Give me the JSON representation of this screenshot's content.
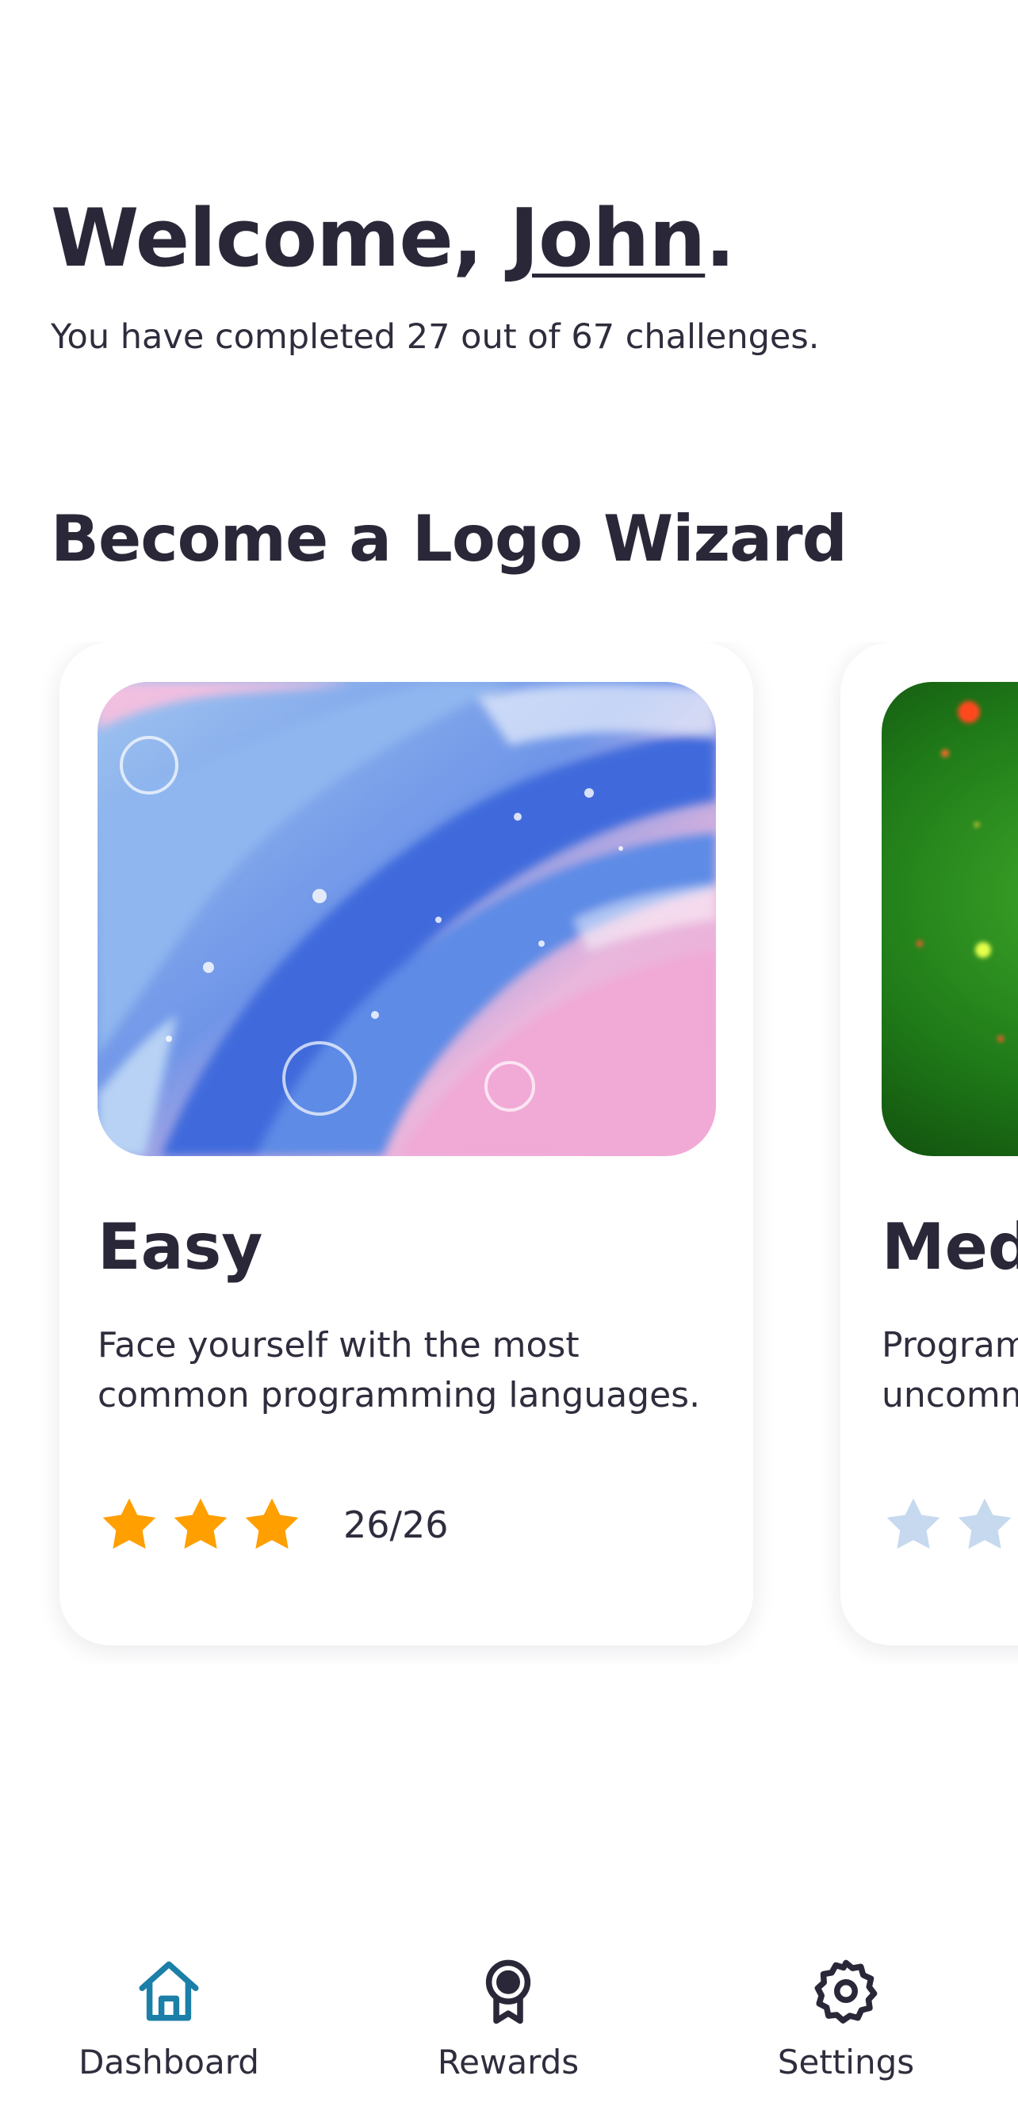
{
  "header": {
    "greeting_prefix": "Welcome, ",
    "user_name": "John",
    "greeting_suffix": ".",
    "progress_text": "You have completed 27 out of 67 challenges."
  },
  "section": {
    "title": "Become a Logo Wizard"
  },
  "cards": [
    {
      "title": "Easy",
      "description": "Face yourself with the most common programming languages.",
      "stars_filled": 3,
      "stars_total": 3,
      "count": "26/26",
      "image": "pink-blue-fluid-art"
    },
    {
      "title": "Med",
      "description_line1": "Program",
      "description_line2": "uncomm",
      "stars_filled": 0,
      "stars_total": 3,
      "image": "green-nebula"
    }
  ],
  "colors": {
    "text": "#2a2838",
    "accent": "#1b7fa8",
    "star_filled": "#ff9f00",
    "star_empty": "#c6d9ee"
  },
  "nav": {
    "items": [
      {
        "label": "Dashboard",
        "icon": "home-icon",
        "active": true
      },
      {
        "label": "Rewards",
        "icon": "award-icon",
        "active": false
      },
      {
        "label": "Settings",
        "icon": "gear-icon",
        "active": false
      }
    ]
  }
}
